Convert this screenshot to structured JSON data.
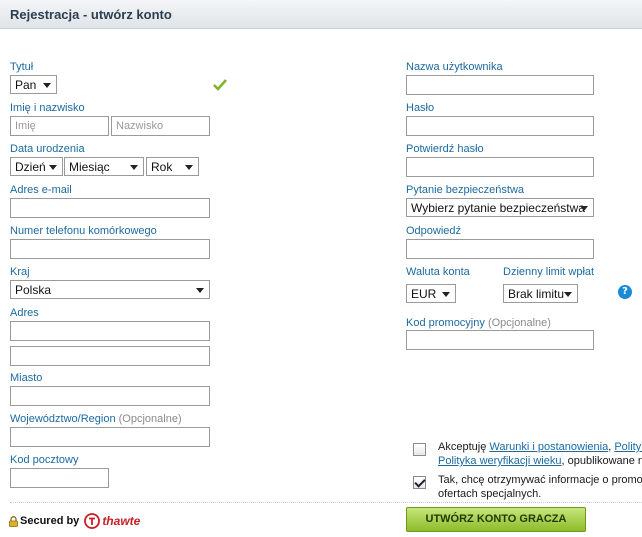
{
  "header": {
    "title": "Rejestracja - utwórz konto"
  },
  "left": {
    "title_label": "Tytuł",
    "title_value": "Pan",
    "name_label": "Imię i nazwisko",
    "first_name_placeholder": "Imię",
    "last_name_placeholder": "Nazwisko",
    "dob_label": "Data urodzenia",
    "dob_day": "Dzień",
    "dob_month": "Miesiąc",
    "dob_year": "Rok",
    "email_label": "Adres e-mail",
    "phone_label": "Numer telefonu komórkowego",
    "country_label": "Kraj",
    "country_value": "Polska",
    "address_label": "Adres",
    "city_label": "Miasto",
    "region_label": "Województwo/Region",
    "region_optional": "(Opcjonalne)",
    "postcode_label": "Kod pocztowy"
  },
  "right": {
    "username_label": "Nazwa użytkownika",
    "password_label": "Hasło",
    "confirm_password_label": "Potwierdź hasło",
    "security_question_label": "Pytanie bezpieczeństwa",
    "security_question_value": "Wybierz pytanie bezpieczeństwa",
    "answer_label": "Odpowiedź",
    "currency_label": "Waluta konta",
    "currency_value": "EUR",
    "deposit_limit_label": "Dzienny limit wpłat",
    "deposit_limit_value": "Brak limitu",
    "promo_label": "Kod promocyjny",
    "promo_optional": "(Opcjonalne)"
  },
  "consent": {
    "terms_prefix": "Akceptuję",
    "terms_link": "Warunki i postanowienia",
    "terms_sep": ",",
    "terms_link2": "Polityk",
    "terms_line2_link": "Polityka weryfikacji wieku",
    "terms_line2_suffix": ", opublikowane n",
    "terms_checked": false,
    "news_line1": "Tak, chcę otrzymywać informacje o promo",
    "news_line2": "ofertach specjalnych.",
    "news_checked": true
  },
  "footer": {
    "secured_text": "Secured by",
    "thawte_text": "thawte",
    "create_button": "UTWÓRZ KONTO GRACZA"
  },
  "colors": {
    "accent_link": "#1c6aa0",
    "button_green": "#8dbb2a",
    "checkmark_green": "#7fb52a",
    "help_blue": "#1c8ad6",
    "thawte_red": "#c62026"
  },
  "icons": {
    "valid": "check-icon",
    "help": "help-icon",
    "lock": "lock-icon",
    "brand": "thawte-logo-icon"
  }
}
